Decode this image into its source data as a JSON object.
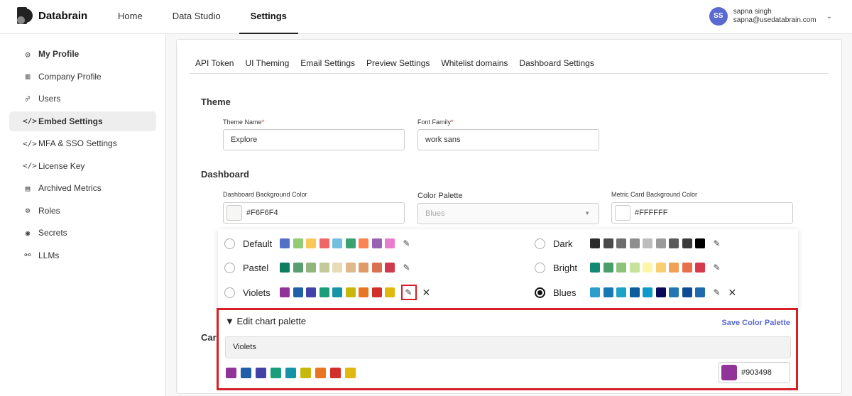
{
  "brand": {
    "name": "Databrain"
  },
  "nav": {
    "items": [
      "Home",
      "Data Studio",
      "Settings"
    ],
    "active": "Settings"
  },
  "user": {
    "initials": "SS",
    "name": "sapna singh",
    "email": "sapna@usedatabrain.com"
  },
  "sidebar": {
    "items": [
      {
        "label": "My Profile",
        "icon": "user-circle-icon",
        "glyph": "◎"
      },
      {
        "label": "Company Profile",
        "icon": "building-icon",
        "glyph": "▥"
      },
      {
        "label": "Users",
        "icon": "users-icon",
        "glyph": "☍"
      },
      {
        "label": "Embed Settings",
        "icon": "code-icon",
        "glyph": "</>"
      },
      {
        "label": "MFA & SSO Settings",
        "icon": "code-icon",
        "glyph": "</>"
      },
      {
        "label": "License Key",
        "icon": "code-icon",
        "glyph": "</>"
      },
      {
        "label": "Archived Metrics",
        "icon": "archive-icon",
        "glyph": "▤"
      },
      {
        "label": "Roles",
        "icon": "roles-icon",
        "glyph": "⚙"
      },
      {
        "label": "Secrets",
        "icon": "secrets-icon",
        "glyph": "◉"
      },
      {
        "label": "LLMs",
        "icon": "llm-icon",
        "glyph": "⚯"
      }
    ],
    "active": "Embed Settings"
  },
  "tabs": [
    "API Token",
    "UI Theming",
    "Email Settings",
    "Preview Settings",
    "Whitelist domains",
    "Dashboard Settings"
  ],
  "theme": {
    "title": "Theme",
    "theme_name_label": "Theme Name",
    "theme_name_value": "Explore",
    "font_family_label": "Font Family",
    "font_family_value": "work sans",
    "required_mark": "*"
  },
  "dashboard": {
    "title": "Dashboard",
    "bg_color_label": "Dashboard Background Color",
    "bg_color_value": "#F6F6F4",
    "palette_label": "Color Palette",
    "palette_value": "Blues",
    "metric_bg_label": "Metric Card Background Color",
    "metric_bg_value": "#FFFFFF"
  },
  "palettes": [
    {
      "name": "Default",
      "colors": [
        "#5470c6",
        "#91cc75",
        "#fac858",
        "#ee6666",
        "#73c0de",
        "#3ba272",
        "#fc8452",
        "#9a60b4",
        "#ea7ccc"
      ],
      "selected": false,
      "deletable": false
    },
    {
      "name": "Dark",
      "colors": [
        "#2b2b2b",
        "#4a4a4a",
        "#6e6e6e",
        "#8e8e8e",
        "#bdbdbd",
        "#9a9a9a",
        "#5a5a5a",
        "#3a3a3a",
        "#000000"
      ],
      "selected": false,
      "deletable": false
    },
    {
      "name": "Pastel",
      "colors": [
        "#0e7c61",
        "#5a9e6f",
        "#91b57c",
        "#c2c99a",
        "#e8dcb5",
        "#e0b98a",
        "#e09a6a",
        "#d9704f",
        "#cf3a4e"
      ],
      "selected": false,
      "deletable": false
    },
    {
      "name": "Bright",
      "colors": [
        "#118a72",
        "#4a9e6b",
        "#8ec37c",
        "#c7e29a",
        "#fff5a8",
        "#f7cf72",
        "#f0a057",
        "#e67049",
        "#d93a4b"
      ],
      "selected": false,
      "deletable": false
    },
    {
      "name": "Violets",
      "colors": [
        "#903498",
        "#1e5fa8",
        "#4242a6",
        "#1a9e7a",
        "#1594a8",
        "#c8b80c",
        "#e8751f",
        "#d22f2b",
        "#e1b80d"
      ],
      "selected": false,
      "deletable": true
    },
    {
      "name": "Blues",
      "colors": [
        "#2c9ecb",
        "#1778b4",
        "#1aa2c8",
        "#0c5d9e",
        "#0e99c9",
        "#0a0a5c",
        "#2577b3",
        "#0b4c94",
        "#1f6aaf"
      ],
      "selected": true,
      "deletable": true
    }
  ],
  "edit_panel": {
    "title": "Edit chart palette",
    "toggle": "▼",
    "save_label": "Save Color Palette",
    "palette_name": "Violets",
    "colors": [
      "#903498",
      "#1e5fa8",
      "#4242a6",
      "#1a9e7a",
      "#1594a8",
      "#c8b80c",
      "#e8751f",
      "#d22f2b",
      "#e1b80d"
    ],
    "selected_hex": "#903498"
  },
  "can_label": "Car"
}
